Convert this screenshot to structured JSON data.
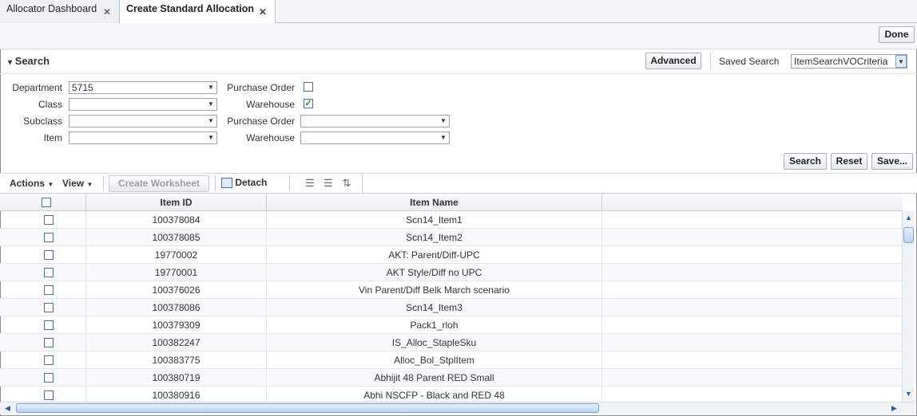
{
  "tabs": [
    {
      "label": "Allocator Dashboard"
    },
    {
      "label": "Create Standard Allocation"
    }
  ],
  "done_label": "Done",
  "search": {
    "title": "Search",
    "advanced_label": "Advanced",
    "saved_search_label": "Saved Search",
    "saved_search_value": "ItemSearchVOCriteria",
    "fields": {
      "department": {
        "label": "Department",
        "value": "5715"
      },
      "class": {
        "label": "Class",
        "value": ""
      },
      "subclass": {
        "label": "Subclass",
        "value": ""
      },
      "item": {
        "label": "Item",
        "value": ""
      },
      "purchase_order_cb": {
        "label": "Purchase Order",
        "checked": false
      },
      "warehouse_cb": {
        "label": "Warehouse",
        "checked": true
      },
      "purchase_order": {
        "label": "Purchase Order",
        "value": ""
      },
      "warehouse": {
        "label": "Warehouse",
        "value": ""
      }
    },
    "buttons": {
      "search": "Search",
      "reset": "Reset",
      "save": "Save..."
    }
  },
  "toolbar": {
    "actions": "Actions",
    "view": "View",
    "create_worksheet": "Create Worksheet",
    "detach": "Detach"
  },
  "table": {
    "columns": [
      "",
      "Item ID",
      "Item Name"
    ],
    "rows": [
      {
        "id": "100378084",
        "name": "Scn14_Item1"
      },
      {
        "id": "100378085",
        "name": "Scn14_Item2"
      },
      {
        "id": "19770002",
        "name": "AKT: Parent/Diff-UPC"
      },
      {
        "id": "19770001",
        "name": "AKT Style/Diff no UPC"
      },
      {
        "id": "100376026",
        "name": "Vin Parent/Diff Belk March scenario"
      },
      {
        "id": "100378086",
        "name": "Scn14_Item3"
      },
      {
        "id": "100379309",
        "name": "Pack1_rloh"
      },
      {
        "id": "100382247",
        "name": "IS_Alloc_StapleSku"
      },
      {
        "id": "100383775",
        "name": "Alloc_Bol_StplItem"
      },
      {
        "id": "100380719",
        "name": "Abhijit 48 Parent RED Small"
      },
      {
        "id": "100380916",
        "name": "Abhi NSCFP - Black and RED 48"
      }
    ]
  }
}
